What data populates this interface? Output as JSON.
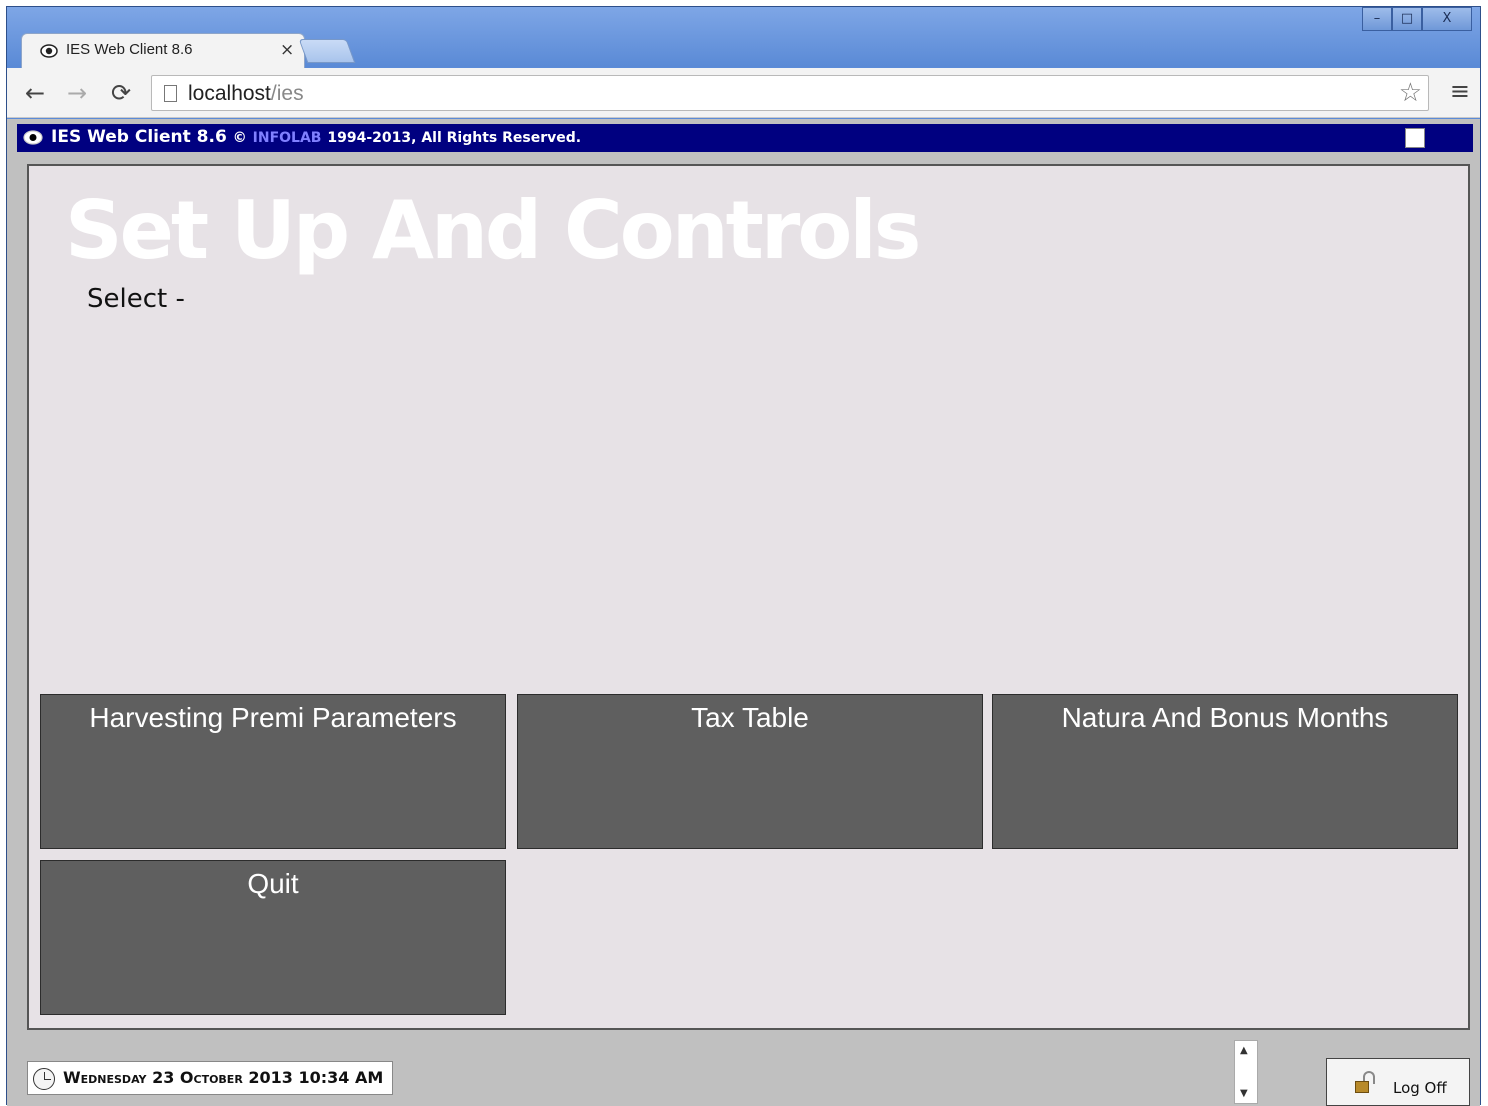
{
  "browser": {
    "tab_title": "IES Web Client 8.6",
    "tab_close": "×",
    "url_host": "localhost",
    "url_path": "/ies",
    "window_buttons": [
      "–",
      "□",
      "X"
    ]
  },
  "app_bar": {
    "title": "IES Web Client 8.6",
    "copyright_symbol": "©",
    "company": "INFOLAB",
    "rights": "1994-2013, All Rights Reserved."
  },
  "page": {
    "heading": "Set Up And Controls",
    "select_label": "Select -"
  },
  "menu": {
    "items": [
      {
        "label": "Harvesting Premi Parameters"
      },
      {
        "label": "Tax Table"
      },
      {
        "label": "Natura And Bonus Months"
      },
      {
        "label": "Quit"
      }
    ]
  },
  "status": {
    "datetime": "Wednesday 23 October 2013 10:34 AM",
    "logoff_label": "Log Off"
  },
  "colors": {
    "app_bar_bg": "#000080",
    "tile_bg": "#5f5f5f",
    "panel_bg": "#e7e2e6"
  }
}
